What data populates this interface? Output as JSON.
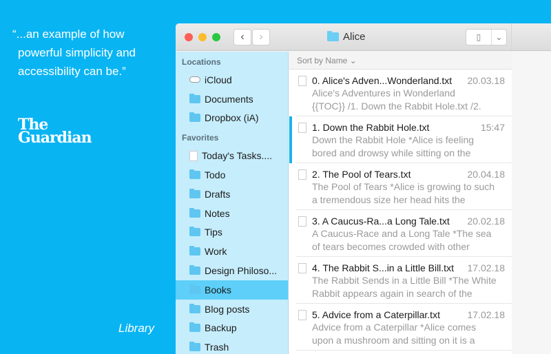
{
  "promo": {
    "quote": [
      "“...an example of how",
      "powerful simplicity and",
      "accessibility can be.”"
    ],
    "logo": [
      "The",
      "Guardian"
    ],
    "caption": "Library"
  },
  "window": {
    "title": "Alice",
    "back": "‹",
    "forward": "›",
    "view_icon": "▯",
    "view_menu": "⌄"
  },
  "sidebar": {
    "locations_label": "Locations",
    "locations": [
      {
        "label": "iCloud",
        "icon": "cloud"
      },
      {
        "label": "Documents",
        "icon": "folder"
      },
      {
        "label": "Dropbox (iA)",
        "icon": "folder"
      }
    ],
    "favorites_label": "Favorites",
    "favorites": [
      {
        "label": "Today's Tasks....",
        "icon": "doc"
      },
      {
        "label": "Todo",
        "icon": "folder"
      },
      {
        "label": "Drafts",
        "icon": "folder"
      },
      {
        "label": "Notes",
        "icon": "folder"
      },
      {
        "label": "Tips",
        "icon": "folder"
      },
      {
        "label": "Work",
        "icon": "folder"
      },
      {
        "label": "Design Philoso...",
        "icon": "folder"
      },
      {
        "label": "Books",
        "icon": "folder",
        "selected": true
      },
      {
        "label": "Blog posts",
        "icon": "folder"
      },
      {
        "label": "Backup",
        "icon": "folder"
      },
      {
        "label": "Trash",
        "icon": "folder"
      }
    ]
  },
  "list": {
    "sort_label": "Sort by Name ⌄",
    "files": [
      {
        "name": "0. Alice's Adven...Wonderland.txt",
        "date": "20.03.18",
        "preview": [
          "Alice's Adventures in Wonderland",
          "{{TOC}} /1. Down the Rabbit Hole.txt /2."
        ]
      },
      {
        "name": "1. Down the Rabbit Hole.txt",
        "date": "15:47",
        "preview": [
          "Down the Rabbit Hole *Alice is feeling",
          "bored and drowsy while sitting on the"
        ],
        "selected": true
      },
      {
        "name": "2. The Pool of Tears.txt",
        "date": "20.04.18",
        "preview": [
          "The Pool of Tears *Alice is growing to such",
          "a tremendous size her head hits the"
        ]
      },
      {
        "name": "3. A Caucus-Ra...a Long Tale.txt",
        "date": "20.02.18",
        "preview": [
          "A Caucus-Race and a Long Tale *The sea",
          "of tears becomes crowded with other"
        ]
      },
      {
        "name": "4. The Rabbit S...in a Little Bill.txt",
        "date": "17.02.18",
        "preview": [
          "The Rabbit Sends in a Little Bill *The White",
          "Rabbit appears again in search of the"
        ]
      },
      {
        "name": "5. Advice from a Caterpillar.txt",
        "date": "17.02.18",
        "preview": [
          "Advice from a Caterpillar *Alice comes",
          "upon a mushroom and sitting on it is a"
        ]
      }
    ]
  }
}
